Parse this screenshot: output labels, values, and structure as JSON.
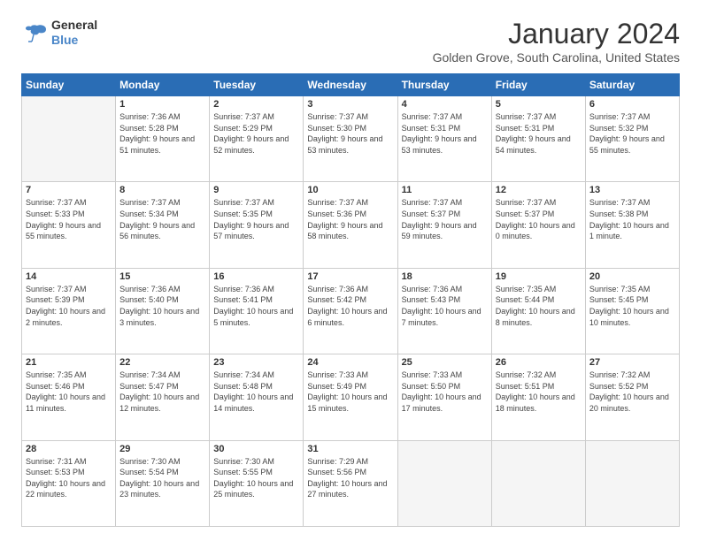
{
  "header": {
    "logo_line1": "General",
    "logo_line2": "Blue",
    "month": "January 2024",
    "location": "Golden Grove, South Carolina, United States"
  },
  "weekdays": [
    "Sunday",
    "Monday",
    "Tuesday",
    "Wednesday",
    "Thursday",
    "Friday",
    "Saturday"
  ],
  "weeks": [
    [
      {
        "day": "",
        "empty": true
      },
      {
        "day": "1",
        "sunrise": "7:36 AM",
        "sunset": "5:28 PM",
        "daylight": "9 hours and 51 minutes."
      },
      {
        "day": "2",
        "sunrise": "7:37 AM",
        "sunset": "5:29 PM",
        "daylight": "9 hours and 52 minutes."
      },
      {
        "day": "3",
        "sunrise": "7:37 AM",
        "sunset": "5:30 PM",
        "daylight": "9 hours and 53 minutes."
      },
      {
        "day": "4",
        "sunrise": "7:37 AM",
        "sunset": "5:31 PM",
        "daylight": "9 hours and 53 minutes."
      },
      {
        "day": "5",
        "sunrise": "7:37 AM",
        "sunset": "5:31 PM",
        "daylight": "9 hours and 54 minutes."
      },
      {
        "day": "6",
        "sunrise": "7:37 AM",
        "sunset": "5:32 PM",
        "daylight": "9 hours and 55 minutes."
      }
    ],
    [
      {
        "day": "7",
        "sunrise": "7:37 AM",
        "sunset": "5:33 PM",
        "daylight": "9 hours and 55 minutes."
      },
      {
        "day": "8",
        "sunrise": "7:37 AM",
        "sunset": "5:34 PM",
        "daylight": "9 hours and 56 minutes."
      },
      {
        "day": "9",
        "sunrise": "7:37 AM",
        "sunset": "5:35 PM",
        "daylight": "9 hours and 57 minutes."
      },
      {
        "day": "10",
        "sunrise": "7:37 AM",
        "sunset": "5:36 PM",
        "daylight": "9 hours and 58 minutes."
      },
      {
        "day": "11",
        "sunrise": "7:37 AM",
        "sunset": "5:37 PM",
        "daylight": "9 hours and 59 minutes."
      },
      {
        "day": "12",
        "sunrise": "7:37 AM",
        "sunset": "5:37 PM",
        "daylight": "10 hours and 0 minutes."
      },
      {
        "day": "13",
        "sunrise": "7:37 AM",
        "sunset": "5:38 PM",
        "daylight": "10 hours and 1 minute."
      }
    ],
    [
      {
        "day": "14",
        "sunrise": "7:37 AM",
        "sunset": "5:39 PM",
        "daylight": "10 hours and 2 minutes."
      },
      {
        "day": "15",
        "sunrise": "7:36 AM",
        "sunset": "5:40 PM",
        "daylight": "10 hours and 3 minutes."
      },
      {
        "day": "16",
        "sunrise": "7:36 AM",
        "sunset": "5:41 PM",
        "daylight": "10 hours and 5 minutes."
      },
      {
        "day": "17",
        "sunrise": "7:36 AM",
        "sunset": "5:42 PM",
        "daylight": "10 hours and 6 minutes."
      },
      {
        "day": "18",
        "sunrise": "7:36 AM",
        "sunset": "5:43 PM",
        "daylight": "10 hours and 7 minutes."
      },
      {
        "day": "19",
        "sunrise": "7:35 AM",
        "sunset": "5:44 PM",
        "daylight": "10 hours and 8 minutes."
      },
      {
        "day": "20",
        "sunrise": "7:35 AM",
        "sunset": "5:45 PM",
        "daylight": "10 hours and 10 minutes."
      }
    ],
    [
      {
        "day": "21",
        "sunrise": "7:35 AM",
        "sunset": "5:46 PM",
        "daylight": "10 hours and 11 minutes."
      },
      {
        "day": "22",
        "sunrise": "7:34 AM",
        "sunset": "5:47 PM",
        "daylight": "10 hours and 12 minutes."
      },
      {
        "day": "23",
        "sunrise": "7:34 AM",
        "sunset": "5:48 PM",
        "daylight": "10 hours and 14 minutes."
      },
      {
        "day": "24",
        "sunrise": "7:33 AM",
        "sunset": "5:49 PM",
        "daylight": "10 hours and 15 minutes."
      },
      {
        "day": "25",
        "sunrise": "7:33 AM",
        "sunset": "5:50 PM",
        "daylight": "10 hours and 17 minutes."
      },
      {
        "day": "26",
        "sunrise": "7:32 AM",
        "sunset": "5:51 PM",
        "daylight": "10 hours and 18 minutes."
      },
      {
        "day": "27",
        "sunrise": "7:32 AM",
        "sunset": "5:52 PM",
        "daylight": "10 hours and 20 minutes."
      }
    ],
    [
      {
        "day": "28",
        "sunrise": "7:31 AM",
        "sunset": "5:53 PM",
        "daylight": "10 hours and 22 minutes."
      },
      {
        "day": "29",
        "sunrise": "7:30 AM",
        "sunset": "5:54 PM",
        "daylight": "10 hours and 23 minutes."
      },
      {
        "day": "30",
        "sunrise": "7:30 AM",
        "sunset": "5:55 PM",
        "daylight": "10 hours and 25 minutes."
      },
      {
        "day": "31",
        "sunrise": "7:29 AM",
        "sunset": "5:56 PM",
        "daylight": "10 hours and 27 minutes."
      },
      {
        "day": "",
        "empty": true
      },
      {
        "day": "",
        "empty": true
      },
      {
        "day": "",
        "empty": true
      }
    ]
  ]
}
